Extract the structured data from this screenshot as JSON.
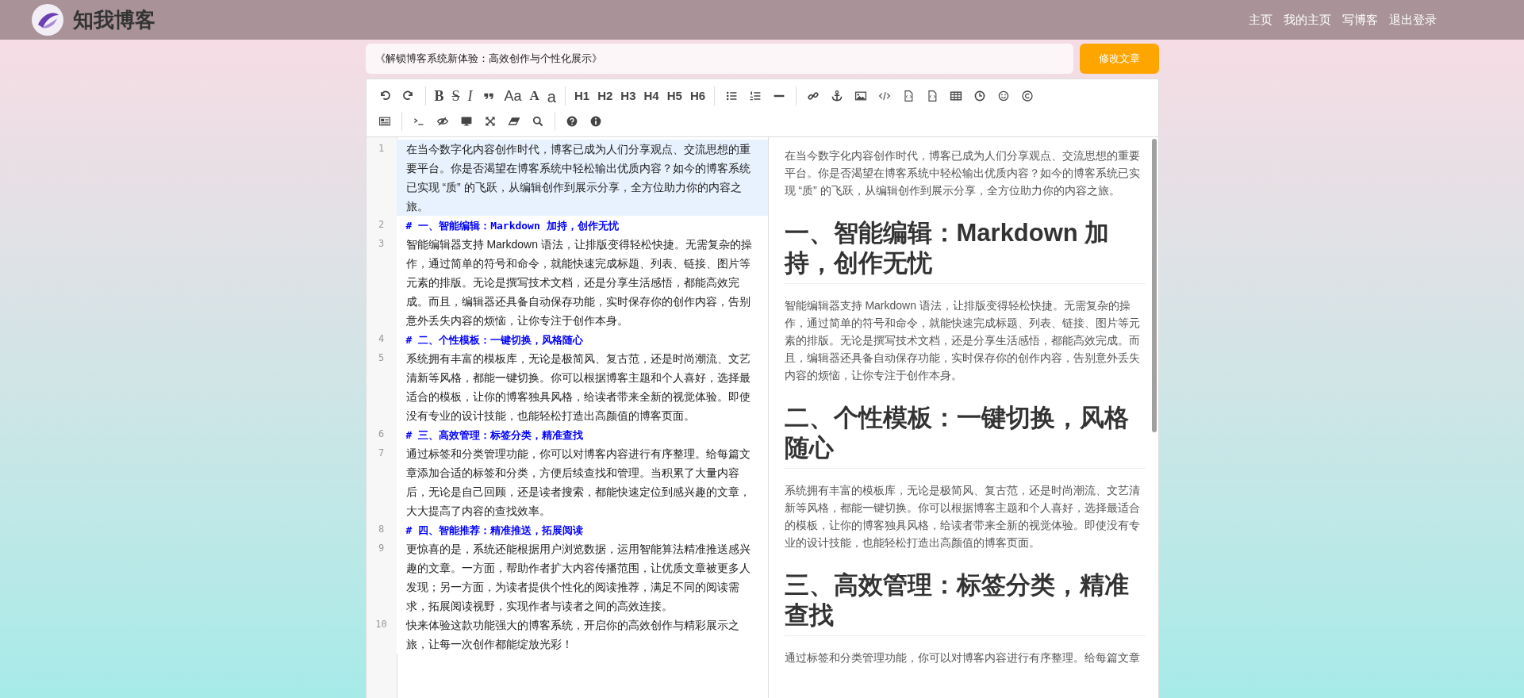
{
  "header": {
    "site_title": "知我博客",
    "nav": [
      {
        "label": "主页"
      },
      {
        "label": "我的主页"
      },
      {
        "label": "写博客"
      },
      {
        "label": "退出登录"
      }
    ]
  },
  "title_field": {
    "value": "《解锁博客系统新体验：高效创作与个性化展示》"
  },
  "submit_button": {
    "label": "修改文章"
  },
  "toolbar": {
    "rows": [
      [
        {
          "kind": "undo"
        },
        {
          "kind": "redo"
        },
        {
          "kind": "divider"
        },
        {
          "kind": "bold",
          "label": "B"
        },
        {
          "kind": "strike",
          "label": "S"
        },
        {
          "kind": "italic",
          "label": "I"
        },
        {
          "kind": "quote"
        },
        {
          "kind": "case",
          "label": "Aa"
        },
        {
          "kind": "upper",
          "label": "A"
        },
        {
          "kind": "lower",
          "label": "a"
        },
        {
          "kind": "divider"
        },
        {
          "kind": "heading",
          "label": "H1"
        },
        {
          "kind": "heading",
          "label": "H2"
        },
        {
          "kind": "heading",
          "label": "H3"
        },
        {
          "kind": "heading",
          "label": "H4"
        },
        {
          "kind": "heading",
          "label": "H5"
        },
        {
          "kind": "heading",
          "label": "H6"
        },
        {
          "kind": "divider"
        },
        {
          "kind": "list-ul"
        },
        {
          "kind": "list-ol"
        },
        {
          "kind": "hr"
        },
        {
          "kind": "divider"
        },
        {
          "kind": "link"
        },
        {
          "kind": "anchor"
        },
        {
          "kind": "image"
        },
        {
          "kind": "code"
        },
        {
          "kind": "file-code"
        },
        {
          "kind": "file-code"
        },
        {
          "kind": "table"
        },
        {
          "kind": "clock"
        },
        {
          "kind": "smile"
        },
        {
          "kind": "copyright"
        }
      ],
      [
        {
          "kind": "newspaper"
        },
        {
          "kind": "divider"
        },
        {
          "kind": "terminal"
        },
        {
          "kind": "eye-slash"
        },
        {
          "kind": "desktop"
        },
        {
          "kind": "expand"
        },
        {
          "kind": "eraser"
        },
        {
          "kind": "search"
        },
        {
          "kind": "divider"
        },
        {
          "kind": "question"
        },
        {
          "kind": "info"
        }
      ]
    ]
  },
  "editor": {
    "lines": [
      {
        "number": "1",
        "kind": "text",
        "active": true,
        "text": "在当今数字化内容创作时代，博客已成为人们分享观点、交流思想的重要平台。你是否渴望在博客系统中轻松输出优质内容？如今的博客系统已实现 “质” 的飞跃，从编辑创作到展示分享，全方位助力你的内容之旅。"
      },
      {
        "number": "2",
        "kind": "heading",
        "active": false,
        "text": "# 一、智能编辑：Markdown 加持，创作无忧"
      },
      {
        "number": "3",
        "kind": "text",
        "active": false,
        "text": "智能编辑器支持 Markdown 语法，让排版变得轻松快捷。无需复杂的操作，通过简单的符号和命令，就能快速完成标题、列表、链接、图片等元素的排版。无论是撰写技术文档，还是分享生活感悟，都能高效完成。而且，编辑器还具备自动保存功能，实时保存你的创作内容，告别意外丢失内容的烦恼，让你专注于创作本身。"
      },
      {
        "number": "4",
        "kind": "heading",
        "active": false,
        "text": "# 二、个性模板：一键切换，风格随心"
      },
      {
        "number": "5",
        "kind": "text",
        "active": false,
        "text": "系统拥有丰富的模板库，无论是极简风、复古范，还是时尚潮流、文艺清新等风格，都能一键切换。你可以根据博客主题和个人喜好，选择最适合的模板，让你的博客独具风格，给读者带来全新的视觉体验。即使没有专业的设计技能，也能轻松打造出高颜值的博客页面。"
      },
      {
        "number": "6",
        "kind": "heading",
        "active": false,
        "text": "# 三、高效管理：标签分类，精准查找"
      },
      {
        "number": "7",
        "kind": "text",
        "active": false,
        "text": "通过标签和分类管理功能，你可以对博客内容进行有序整理。给每篇文章添加合适的标签和分类，方便后续查找和管理。当积累了大量内容后，无论是自己回顾，还是读者搜索，都能快速定位到感兴趣的文章，大大提高了内容的查找效率。"
      },
      {
        "number": "8",
        "kind": "heading",
        "active": false,
        "text": "# 四、智能推荐：精准推送，拓展阅读"
      },
      {
        "number": "9",
        "kind": "text",
        "active": false,
        "text": "更惊喜的是，系统还能根据用户浏览数据，运用智能算法精准推送感兴趣的文章。一方面，帮助作者扩大内容传播范围，让优质文章被更多人发现；另一方面，为读者提供个性化的阅读推荐，满足不同的阅读需求，拓展阅读视野，实现作者与读者之间的高效连接。"
      },
      {
        "number": "10",
        "kind": "text",
        "active": false,
        "text": "快来体验这款功能强大的博客系统，开启你的高效创作与精彩展示之旅，让每一次创作都能绽放光彩！"
      }
    ]
  },
  "preview": {
    "blocks": [
      {
        "kind": "paragraph",
        "text": "在当今数字化内容创作时代，博客已成为人们分享观点、交流思想的重要平台。你是否渴望在博客系统中轻松输出优质内容？如今的博客系统已实现 “质” 的飞跃，从编辑创作到展示分享，全方位助力你的内容之旅。"
      },
      {
        "kind": "heading",
        "text": "一、智能编辑：Markdown 加持，创作无忧"
      },
      {
        "kind": "paragraph",
        "text": "智能编辑器支持 Markdown 语法，让排版变得轻松快捷。无需复杂的操作，通过简单的符号和命令，就能快速完成标题、列表、链接、图片等元素的排版。无论是撰写技术文档，还是分享生活感悟，都能高效完成。而且，编辑器还具备自动保存功能，实时保存你的创作内容，告别意外丢失内容的烦恼，让你专注于创作本身。"
      },
      {
        "kind": "heading",
        "text": "二、个性模板：一键切换，风格随心"
      },
      {
        "kind": "paragraph",
        "text": "系统拥有丰富的模板库，无论是极简风、复古范，还是时尚潮流、文艺清新等风格，都能一键切换。你可以根据博客主题和个人喜好，选择最适合的模板，让你的博客独具风格，给读者带来全新的视觉体验。即使没有专业的设计技能，也能轻松打造出高颜值的博客页面。"
      },
      {
        "kind": "heading",
        "text": "三、高效管理：标签分类，精准查找"
      },
      {
        "kind": "paragraph",
        "text": "通过标签和分类管理功能，你可以对博客内容进行有序整理。给每篇文章"
      }
    ]
  }
}
